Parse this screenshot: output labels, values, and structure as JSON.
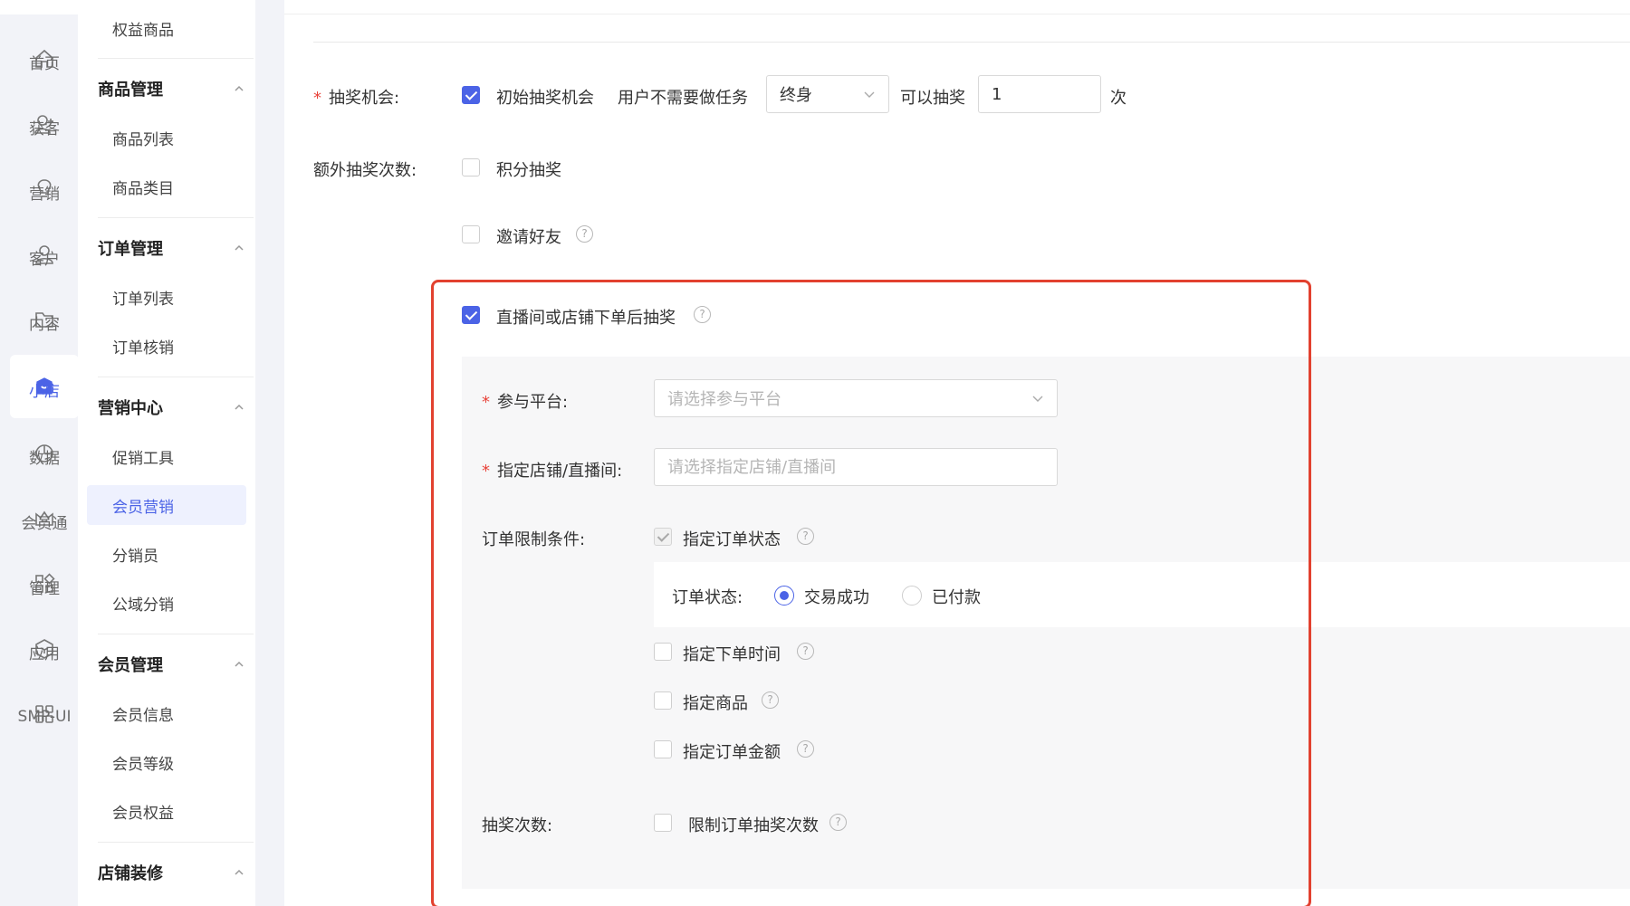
{
  "rail": {
    "items": [
      {
        "label": "首页",
        "icon": "home-icon"
      },
      {
        "label": "获客",
        "icon": "user-add-icon"
      },
      {
        "label": "营销",
        "icon": "bulb-icon"
      },
      {
        "label": "客户",
        "icon": "user-icon"
      },
      {
        "label": "内容",
        "icon": "folder-icon"
      },
      {
        "label": "小店",
        "icon": "shop-icon",
        "active": true
      },
      {
        "label": "数据",
        "icon": "pie-chart-icon"
      },
      {
        "label": "会员通",
        "icon": "crown-icon"
      },
      {
        "label": "管理",
        "icon": "grid-icon"
      },
      {
        "label": "应用",
        "icon": "cube-icon"
      },
      {
        "label": "SMP-UI",
        "icon": "apps-icon"
      }
    ]
  },
  "menu": {
    "top_item": "权益商品",
    "groups": [
      {
        "title": "商品管理",
        "items": [
          "商品列表",
          "商品类目"
        ]
      },
      {
        "title": "订单管理",
        "items": [
          "订单列表",
          "订单核销"
        ]
      },
      {
        "title": "营销中心",
        "items": [
          "促销工具",
          "会员营销",
          "分销员",
          "公域分销"
        ]
      },
      {
        "title": "会员管理",
        "items": [
          "会员信息",
          "会员等级",
          "会员权益"
        ]
      },
      {
        "title": "店铺装修",
        "items": []
      }
    ],
    "active_item": "会员营销"
  },
  "form": {
    "chance": {
      "label": "抽奖机会:",
      "checkbox_label": "初始抽奖机会",
      "text_before": "用户不需要做任务",
      "period_value": "终身",
      "text_middle": "可以抽奖",
      "count_value": "1",
      "unit": "次"
    },
    "extra": {
      "label": "额外抽奖次数:",
      "points_label": "积分抽奖",
      "invite_label": "邀请好友"
    },
    "order_draw": {
      "checkbox_label": "直播间或店铺下单后抽奖",
      "platform_label": "参与平台:",
      "platform_placeholder": "请选择参与平台",
      "store_label": "指定店铺/直播间:",
      "store_placeholder": "请选择指定店铺/直播间",
      "condition_label": "订单限制条件:",
      "status_checkbox": "指定订单状态",
      "status_label": "订单状态:",
      "status_options": [
        "交易成功",
        "已付款"
      ],
      "time_checkbox": "指定下单时间",
      "goods_checkbox": "指定商品",
      "amount_checkbox": "指定订单金额",
      "times_label": "抽奖次数:",
      "times_checkbox": "限制订单抽奖次数"
    }
  },
  "colors": {
    "primary": "#4b63e6",
    "required": "#e8433a",
    "highlight": "#e2412f"
  }
}
